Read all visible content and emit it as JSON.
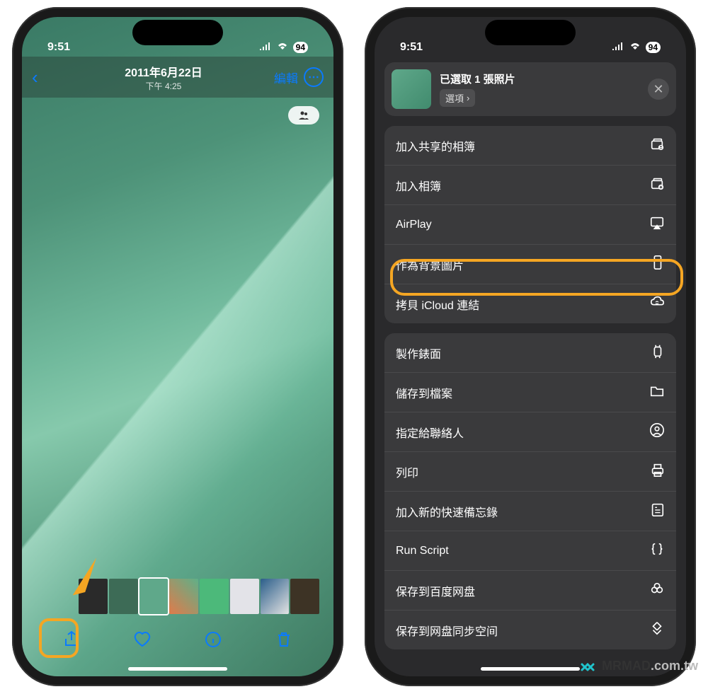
{
  "status": {
    "time": "9:51",
    "battery": "94"
  },
  "left": {
    "date": "2011年6月22日",
    "time": "下午 4:25",
    "edit": "編輯",
    "thumbs": [
      {
        "bg": "#2a2a2a"
      },
      {
        "bg": "#3d6b56"
      },
      {
        "bg": "#5fa88a"
      },
      {
        "bg": "linear-gradient(45deg,#e07b4b,#5fb088)"
      },
      {
        "bg": "#4cb97a"
      },
      {
        "bg": "#e3e3e8"
      },
      {
        "bg": "linear-gradient(135deg,#2b5e8a,#e3e3e3)"
      },
      {
        "bg": "#3d3325"
      }
    ]
  },
  "right": {
    "selected": "已選取 1 張照片",
    "options": "選項",
    "group1": [
      {
        "label": "加入共享的相簿",
        "icon": "album-shared"
      },
      {
        "label": "加入相簿",
        "icon": "album-add"
      },
      {
        "label": "AirPlay",
        "icon": "airplay"
      },
      {
        "label": "作為背景圖片",
        "icon": "phone",
        "highlight": true
      },
      {
        "label": "拷貝 iCloud 連結",
        "icon": "icloud-link"
      }
    ],
    "group2": [
      {
        "label": "製作錶面",
        "icon": "watch"
      },
      {
        "label": "儲存到檔案",
        "icon": "folder"
      },
      {
        "label": "指定給聯絡人",
        "icon": "contact"
      },
      {
        "label": "列印",
        "icon": "print"
      },
      {
        "label": "加入新的快速備忘錄",
        "icon": "note"
      },
      {
        "label": "Run Script",
        "icon": "braces"
      },
      {
        "label": "保存到百度网盘",
        "icon": "cloud3"
      },
      {
        "label": "保存到网盘同步空间",
        "icon": "sync"
      }
    ]
  },
  "watermark": {
    "text": "MRMAD",
    "suffix": ".com.tw"
  }
}
